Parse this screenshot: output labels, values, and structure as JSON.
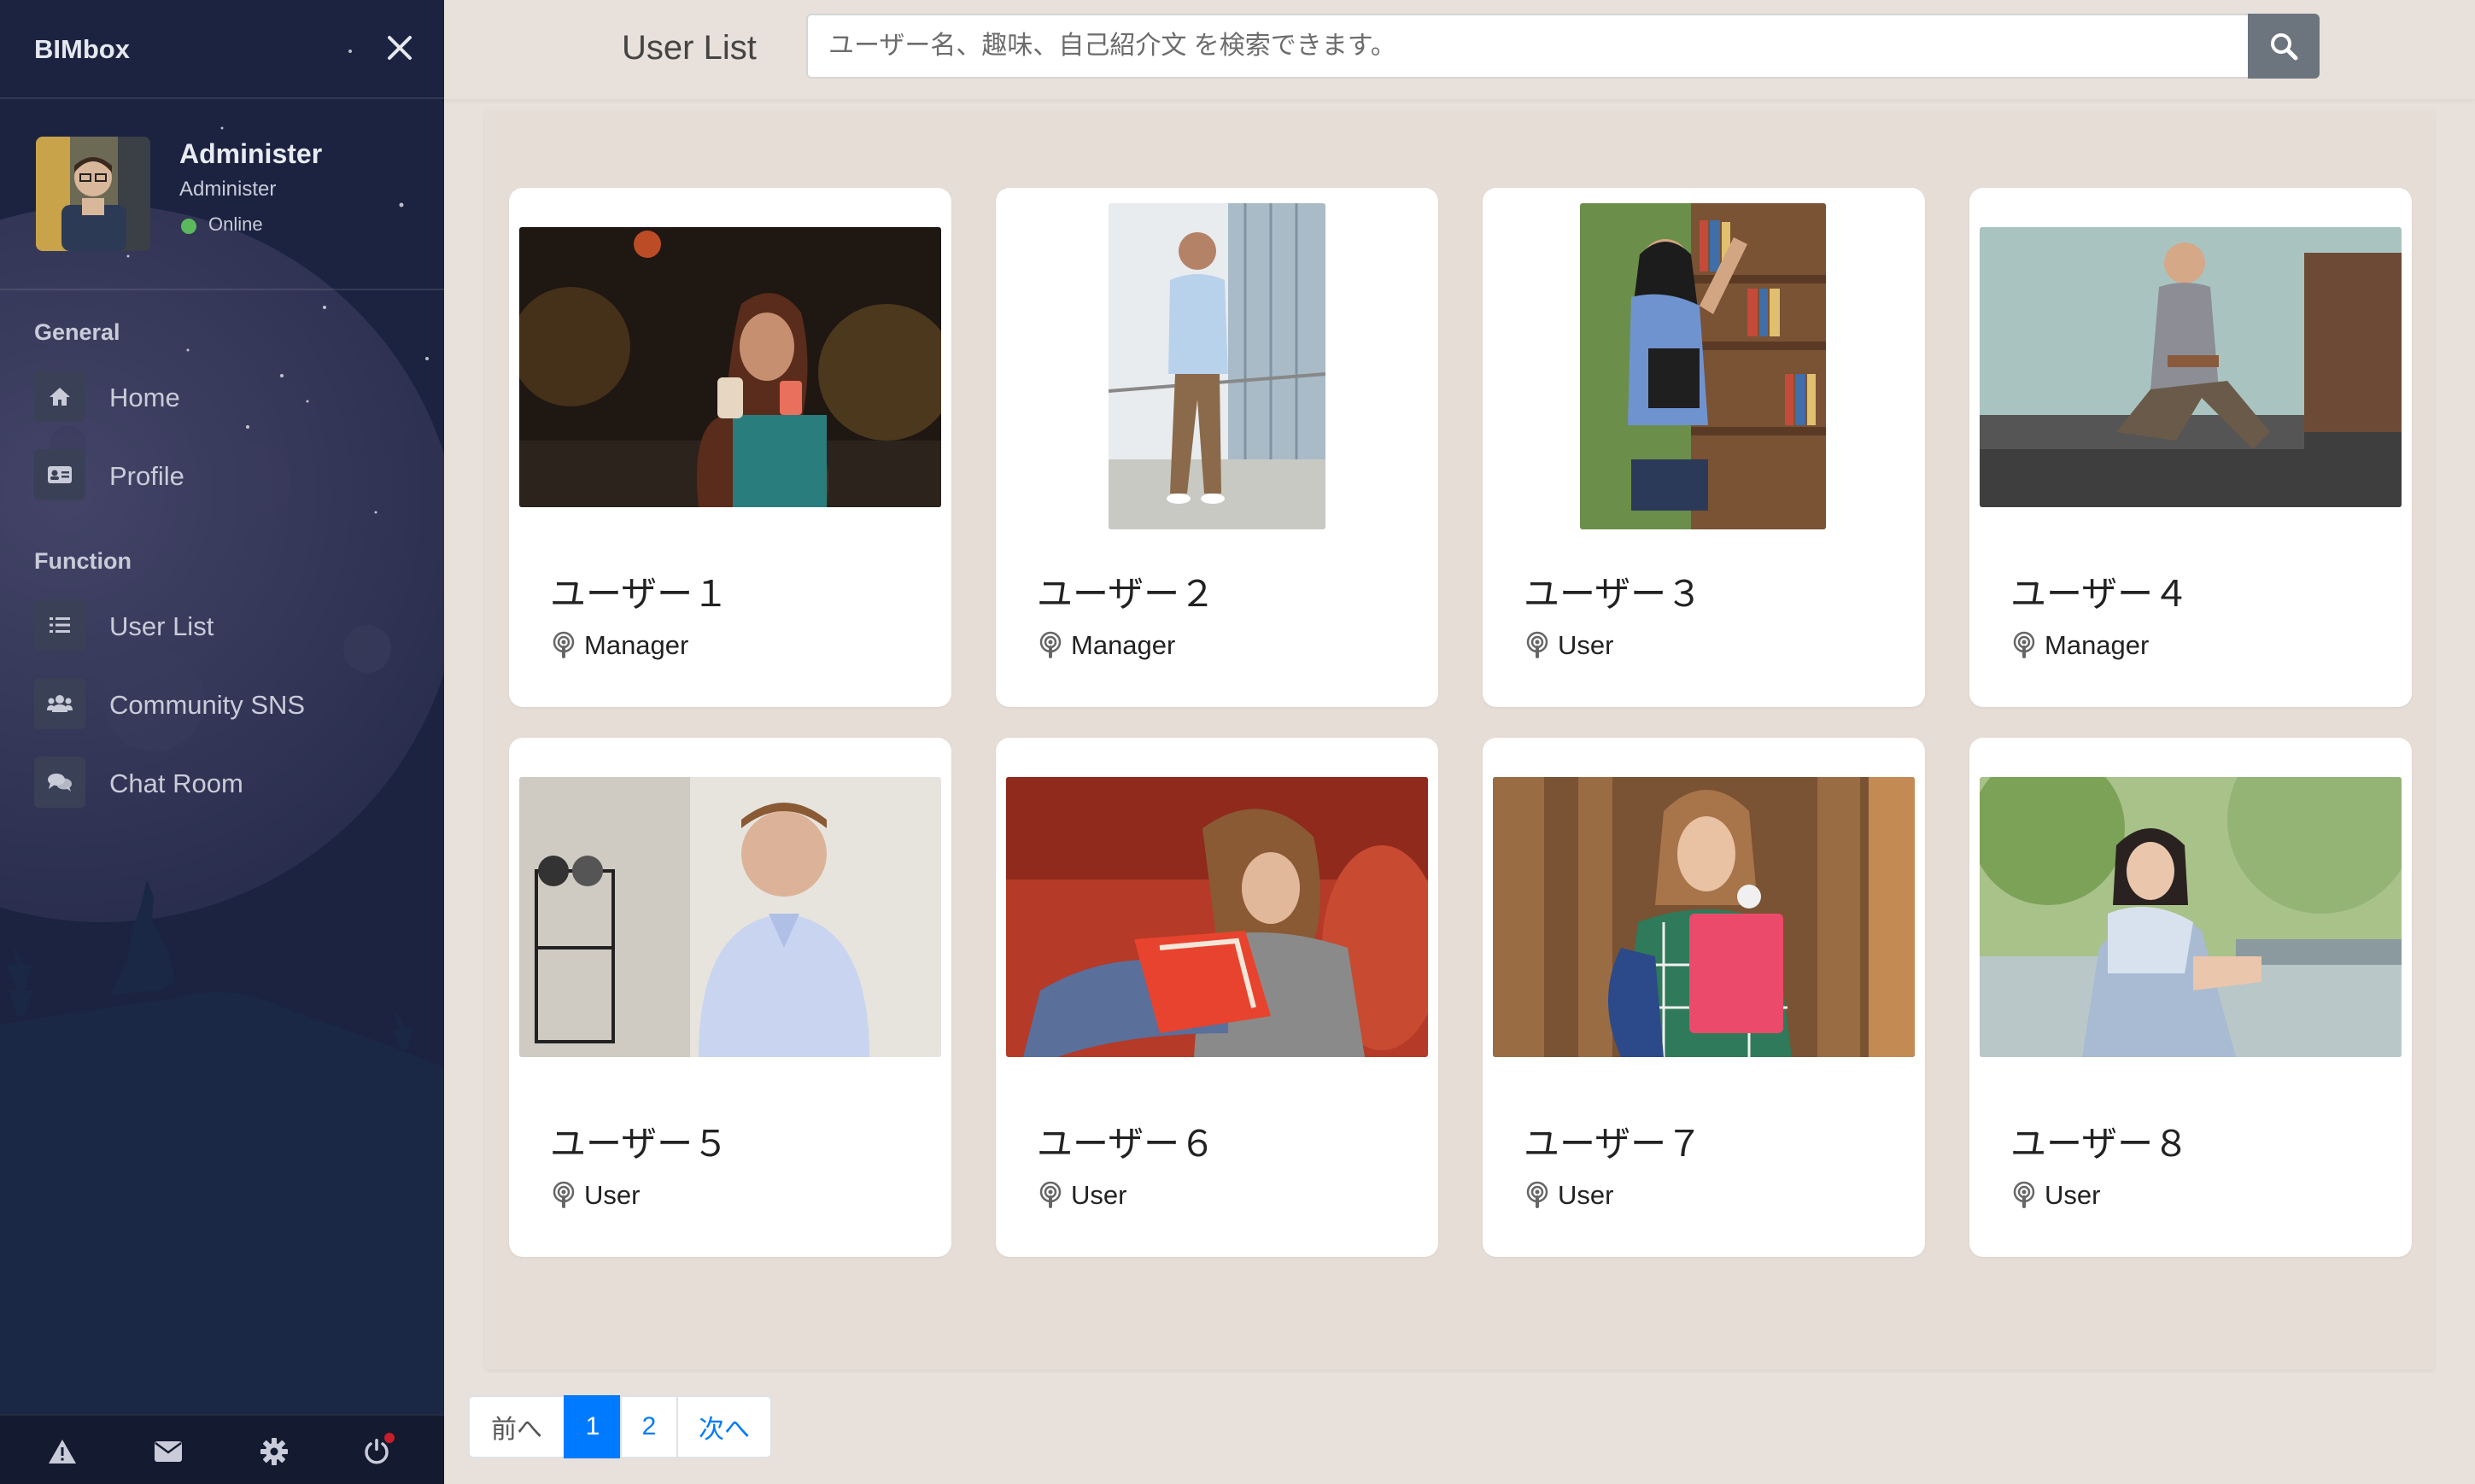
{
  "sidebar": {
    "brand": "BIMbox",
    "profile": {
      "name": "Administer",
      "role": "Administer",
      "status": "Online"
    },
    "sections": [
      {
        "title": "General",
        "items": [
          {
            "label": "Home",
            "icon": "home-icon"
          },
          {
            "label": "Profile",
            "icon": "id-card-icon"
          }
        ]
      },
      {
        "title": "Function",
        "items": [
          {
            "label": "User List",
            "icon": "list-icon"
          },
          {
            "label": "Community SNS",
            "icon": "users-icon"
          },
          {
            "label": "Chat Room",
            "icon": "chat-icon"
          }
        ]
      }
    ],
    "footer_icons": [
      "warning-icon",
      "mail-icon",
      "gear-icon",
      "power-icon"
    ]
  },
  "header": {
    "title": "User List",
    "search_placeholder": "ユーザー名、趣味、自己紹介文 を検索できます。"
  },
  "users": [
    {
      "name": "ユーザー１",
      "role": "Manager"
    },
    {
      "name": "ユーザー２",
      "role": "Manager"
    },
    {
      "name": "ユーザー３",
      "role": "User"
    },
    {
      "name": "ユーザー４",
      "role": "Manager"
    },
    {
      "name": "ユーザー５",
      "role": "User"
    },
    {
      "name": "ユーザー６",
      "role": "User"
    },
    {
      "name": "ユーザー７",
      "role": "User"
    },
    {
      "name": "ユーザー８",
      "role": "User"
    }
  ],
  "pagination": {
    "prev": "前へ",
    "pages": [
      "1",
      "2"
    ],
    "current": "1",
    "next": "次へ"
  },
  "colors": {
    "sidebar_bg": "#1b2340",
    "accent": "#007bff",
    "online": "#5cb85c",
    "content_bg": "#e8e0da"
  }
}
